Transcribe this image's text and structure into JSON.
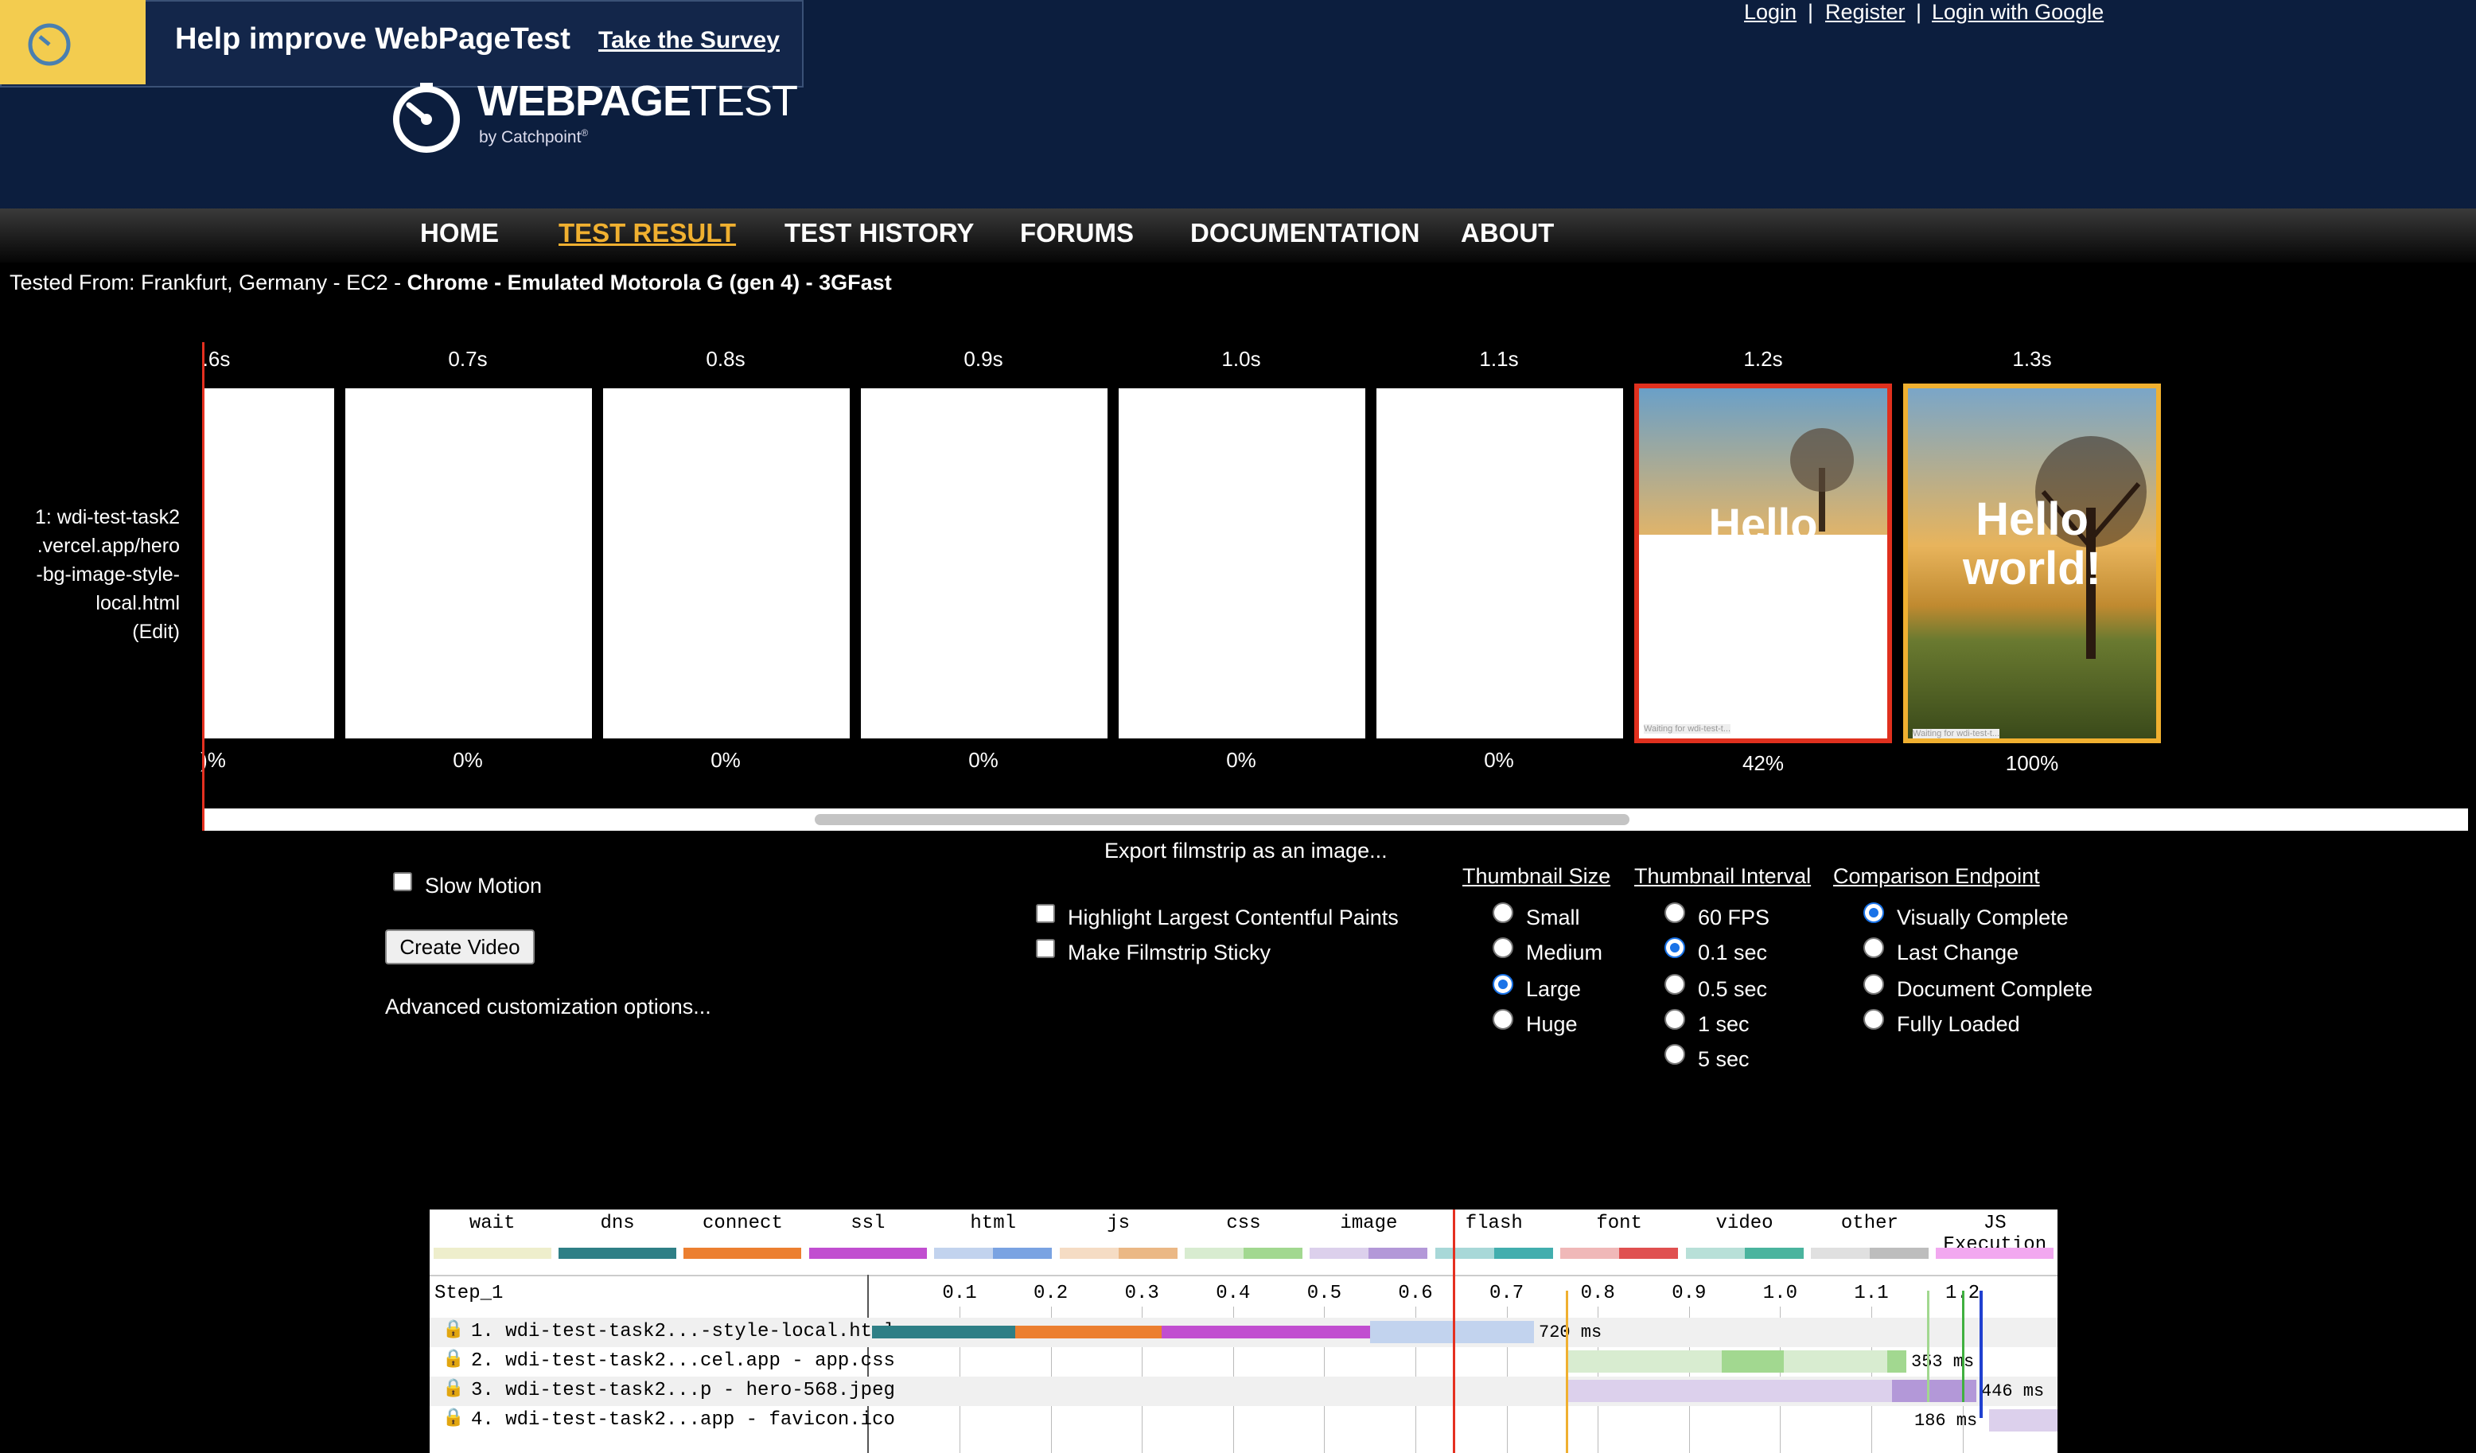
{
  "auth": {
    "login": "Login",
    "register": "Register",
    "login_google": "Login with Google",
    "sep": "|"
  },
  "logo": {
    "web": "WEB",
    "page": "PAGE",
    "test": "TEST",
    "by": "by Catchpoint",
    "reg": "®"
  },
  "survey": {
    "text": "Help improve WebPageTest",
    "cta": "Take the Survey"
  },
  "nav": {
    "home": "HOME",
    "test_result": "TEST RESULT",
    "test_history": "TEST HISTORY",
    "forums": "FORUMS",
    "documentation": "DOCUMENTATION",
    "about": "ABOUT"
  },
  "tested_from": {
    "prefix": "Tested From: Frankfurt, Germany - EC2 - ",
    "bold": "Chrome - Emulated Motorola G (gen 4) - 3GFast"
  },
  "filmstrip": {
    "test_name_lines": [
      "1: wdi-test-task2",
      ".vercel.app/hero",
      "-bg-image-style-",
      "local.html",
      "(Edit)"
    ],
    "frames": [
      {
        "time": ".6s",
        "pct": ")%"
      },
      {
        "time": "0.7s",
        "pct": "0%"
      },
      {
        "time": "0.8s",
        "pct": "0%"
      },
      {
        "time": "0.9s",
        "pct": "0%"
      },
      {
        "time": "1.0s",
        "pct": "0%"
      },
      {
        "time": "1.1s",
        "pct": "0%"
      },
      {
        "time": "1.2s",
        "pct": "42%"
      },
      {
        "time": "1.3s",
        "pct": "100%"
      }
    ],
    "hero_text": "Hello world!",
    "hero_partial": "Hello",
    "status_small": "Waiting for wdi-test-t..."
  },
  "controls": {
    "slow_motion": "Slow Motion",
    "create_video": "Create Video",
    "advanced": "Advanced customization options...",
    "export": "Export filmstrip as an image...",
    "highlight_lcp": "Highlight Largest Contentful Paints",
    "sticky": "Make Filmstrip Sticky",
    "thumb_size": {
      "title": "Thumbnail Size",
      "options": [
        "Small",
        "Medium",
        "Large",
        "Huge"
      ],
      "selected": "Large"
    },
    "thumb_interval": {
      "title": "Thumbnail Interval",
      "options": [
        "60 FPS",
        "0.1 sec",
        "0.5 sec",
        "1 sec",
        "5 sec"
      ],
      "selected": "0.1 sec"
    },
    "comparison": {
      "title": "Comparison Endpoint",
      "options": [
        "Visually Complete",
        "Last Change",
        "Document Complete",
        "Fully Loaded"
      ],
      "selected": "Visually Complete"
    }
  },
  "waterfall": {
    "legend": [
      {
        "name": "wait",
        "c1": "#eeeecc",
        "c2": "#eeeecc"
      },
      {
        "name": "dns",
        "c1": "#2e7f86",
        "c2": "#2e7f86"
      },
      {
        "name": "connect",
        "c1": "#ec7f30",
        "c2": "#ec7f30"
      },
      {
        "name": "ssl",
        "c1": "#c14ed0",
        "c2": "#c14ed0"
      },
      {
        "name": "html",
        "c1": "#c2d3ee",
        "c2": "#7aa3e2"
      },
      {
        "name": "js",
        "c1": "#f5dcc4",
        "c2": "#ebb885"
      },
      {
        "name": "css",
        "c1": "#d8ecd0",
        "c2": "#a2d890"
      },
      {
        "name": "image",
        "c1": "#dcd0ec",
        "c2": "#b398d8"
      },
      {
        "name": "flash",
        "c1": "#a8d8d8",
        "c2": "#42aeae"
      },
      {
        "name": "font",
        "c1": "#f0b8b8",
        "c2": "#e05050"
      },
      {
        "name": "video",
        "c1": "#b8e0d8",
        "c2": "#4ab49e"
      },
      {
        "name": "other",
        "c1": "#e0e0e0",
        "c2": "#bdbdbd"
      },
      {
        "name": "JS Execution",
        "c1": "#f2a8f0",
        "c2": "#f2a8f0"
      }
    ],
    "step": "Step_1",
    "ticks": [
      "0.1",
      "0.2",
      "0.3",
      "0.4",
      "0.5",
      "0.6",
      "0.7",
      "0.8",
      "0.9",
      "1.0",
      "1.1",
      "1.2"
    ],
    "rows": [
      {
        "label": "1. wdi-test-task2...-style-local.html",
        "ms": "720 ms"
      },
      {
        "label": "2. wdi-test-task2...cel.app - app.css",
        "ms": "353 ms"
      },
      {
        "label": "3. wdi-test-task2...p - hero-568.jpeg",
        "ms": "446 ms"
      },
      {
        "label": "4. wdi-test-task2...app - favicon.ico",
        "ms": "186 ms"
      }
    ]
  }
}
